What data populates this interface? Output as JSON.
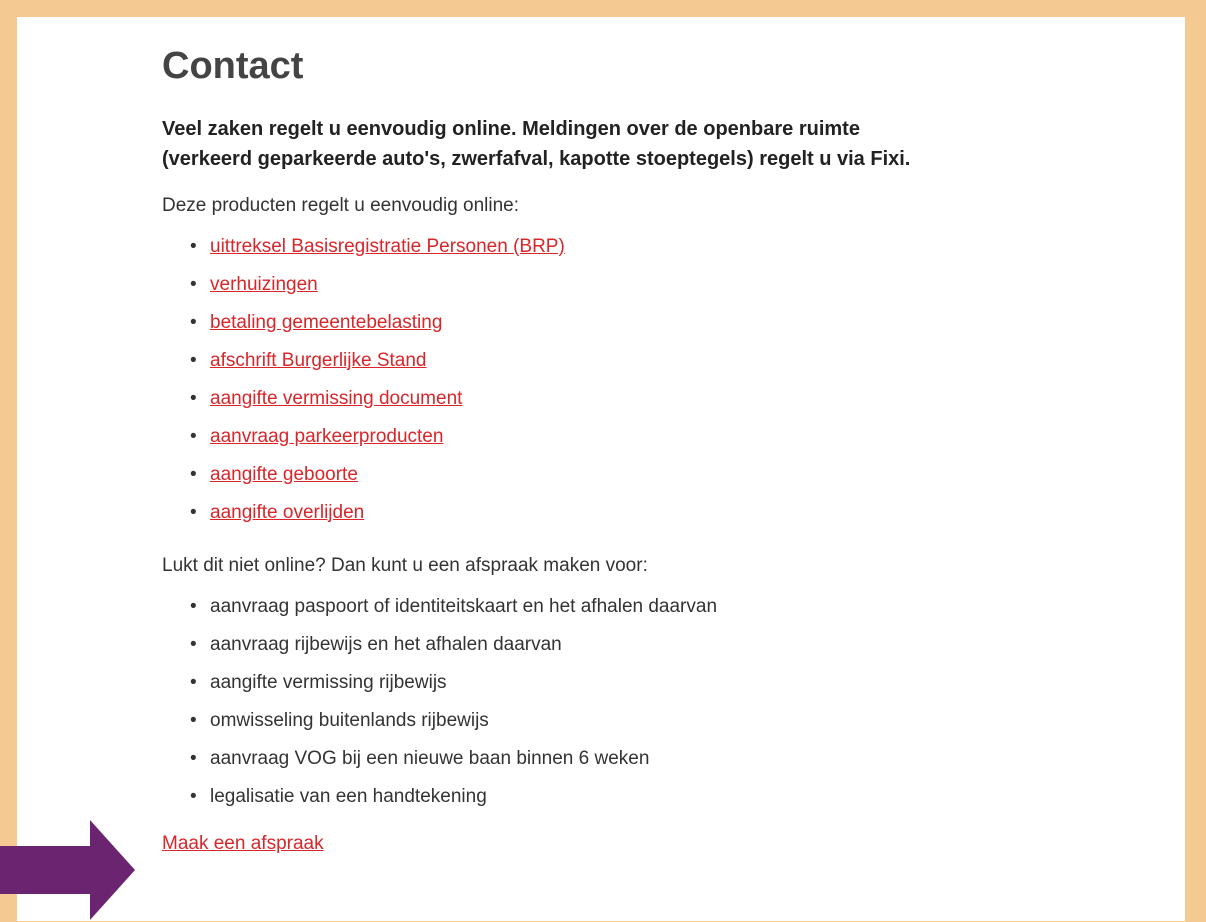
{
  "page": {
    "title": "Contact",
    "intro": "Veel zaken regelt u eenvoudig online. Meldingen over de openbare ruimte (verkeerd geparkeerde auto's, zwerfafval, kapotte stoeptegels) regelt u via Fixi.",
    "online_heading": "Deze producten regelt u eenvoudig online:",
    "online_links": [
      "uittreksel Basisregistratie Personen (BRP)",
      "verhuizingen",
      "betaling gemeentebelasting",
      "afschrift Burgerlijke Stand",
      "aangifte vermissing document",
      "aanvraag parkeerproducten",
      "aangifte geboorte",
      "aangifte overlijden"
    ],
    "appointment_heading": "Lukt dit niet online? Dan kunt u een afspraak maken voor:",
    "appointment_items": [
      "aanvraag paspoort of identiteitskaart en het afhalen daarvan",
      "aanvraag rijbewijs en het afhalen daarvan",
      "aangifte vermissing rijbewijs",
      "omwisseling buitenlands rijbewijs",
      "aanvraag VOG bij een nieuwe baan binnen 6 weken",
      "legalisatie van een handtekening"
    ],
    "cta_label": "Maak een afspraak"
  },
  "colors": {
    "frame": "#f5c992",
    "link": "#d8262a",
    "arrow": "#6b2470",
    "heading": "#444444"
  },
  "icons": {
    "arrow": "right-arrow-icon",
    "bullet": "bullet-dot-icon"
  }
}
